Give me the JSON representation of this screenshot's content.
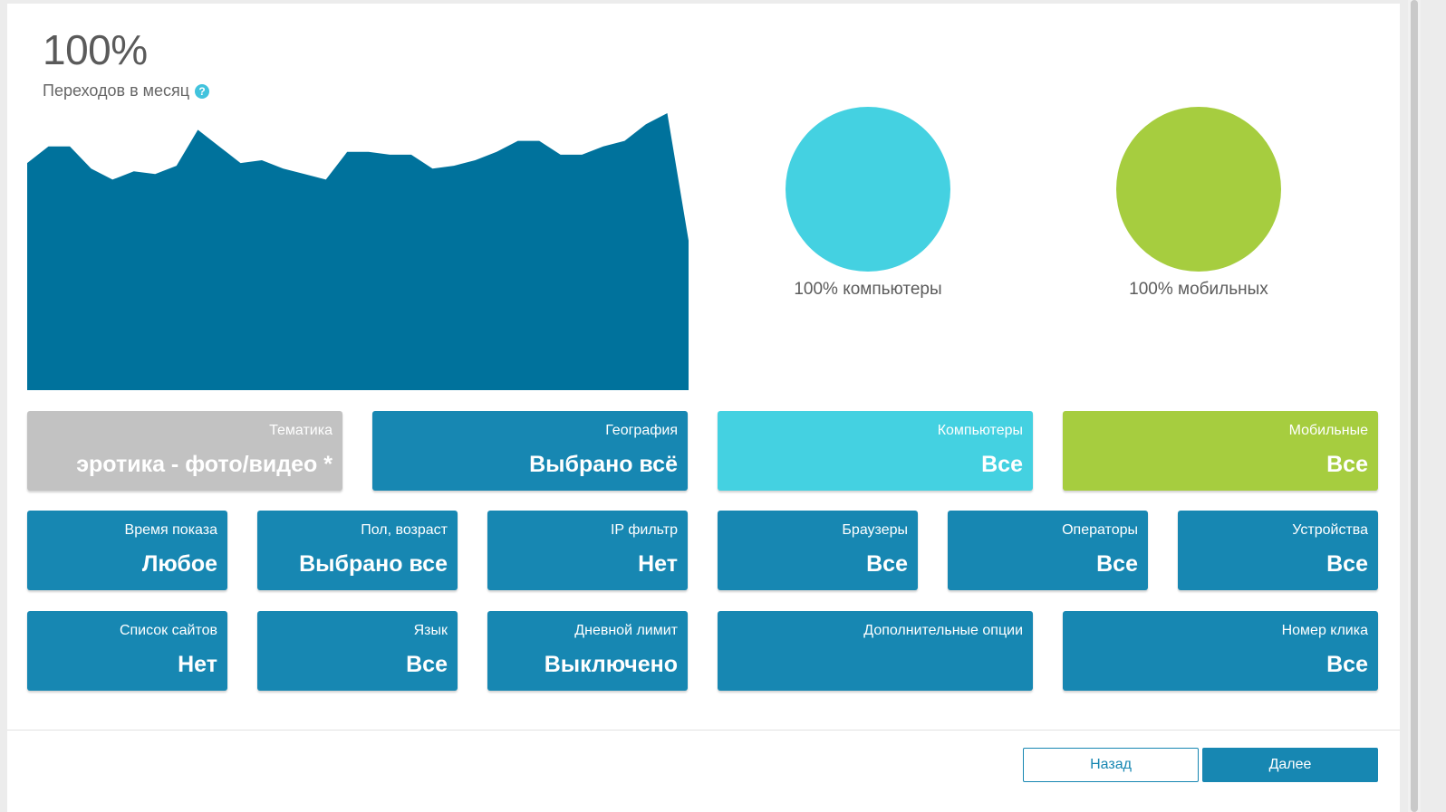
{
  "header": {
    "percent": "100%",
    "subtitle": "Переходов в месяц",
    "help_icon": "question-circle-icon"
  },
  "chart_data": {
    "type": "area",
    "title": "",
    "xlabel": "",
    "ylabel": "",
    "color": "#00729c",
    "ylim": [
      0,
      100
    ],
    "values": [
      82,
      88,
      88,
      80,
      76,
      79,
      78,
      81,
      94,
      88,
      82,
      83,
      80,
      78,
      76,
      86,
      86,
      85,
      85,
      80,
      81,
      83,
      86,
      90,
      90,
      85,
      85,
      88,
      90,
      96,
      100,
      54
    ]
  },
  "devices": {
    "computers": {
      "label": "100% компьютеры",
      "color": "#44d1e1"
    },
    "mobile": {
      "label": "100% мобильных",
      "color": "#a6cd3f"
    }
  },
  "tiles": {
    "theme": {
      "label": "Тематика",
      "value": "эротика - фото/видео *",
      "color": "#c2c2c2"
    },
    "geo": {
      "label": "География",
      "value": "Выбрано всё"
    },
    "computers": {
      "label": "Компьютеры",
      "value": "Все",
      "color": "#44d1e1"
    },
    "mobile": {
      "label": "Мобильные",
      "value": "Все",
      "color": "#a6cd3f"
    },
    "time": {
      "label": "Время показа",
      "value": "Любое"
    },
    "gender_age": {
      "label": "Пол, возраст",
      "value": "Выбрано все"
    },
    "ip_filter": {
      "label": "IP фильтр",
      "value": "Нет"
    },
    "browsers": {
      "label": "Браузеры",
      "value": "Все"
    },
    "operators": {
      "label": "Операторы",
      "value": "Все"
    },
    "devices": {
      "label": "Устройства",
      "value": "Все"
    },
    "sites": {
      "label": "Список сайтов",
      "value": "Нет"
    },
    "language": {
      "label": "Язык",
      "value": "Все"
    },
    "daily_limit": {
      "label": "Дневной лимит",
      "value": "Выключено"
    },
    "extra": {
      "label": "Дополнительные опции",
      "value": ""
    },
    "click_number": {
      "label": "Номер клика",
      "value": "Все"
    }
  },
  "footer": {
    "back_label": "Назад",
    "next_label": "Далее",
    "accent": "#1787b2"
  }
}
